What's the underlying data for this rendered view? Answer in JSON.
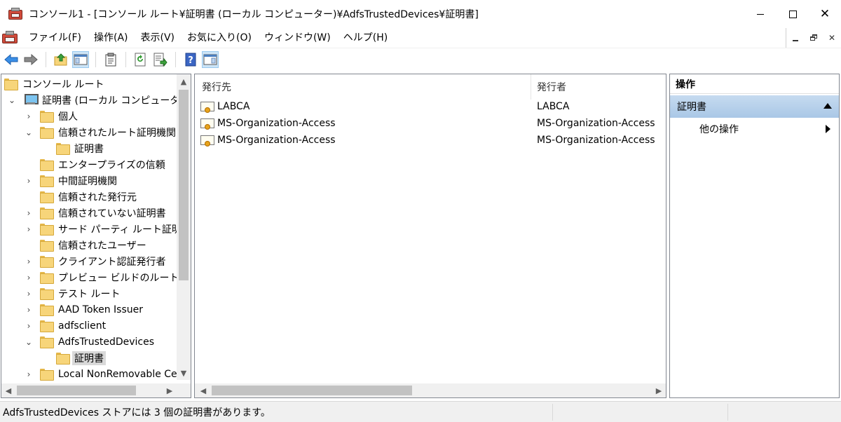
{
  "window": {
    "title": "コンソール1 - [コンソール ルート¥証明書 (ローカル コンピューター)¥AdfsTrustedDevices¥証明書]",
    "controls": {
      "minimize": "minimize-icon",
      "maximize": "maximize-icon",
      "close": "close-icon",
      "close_glyph": "✕"
    }
  },
  "menubar": {
    "items": [
      {
        "label": "ファイル(F)"
      },
      {
        "label": "操作(A)"
      },
      {
        "label": "表示(V)"
      },
      {
        "label": "お気に入り(O)"
      },
      {
        "label": "ウィンドウ(W)"
      },
      {
        "label": "ヘルプ(H)"
      }
    ]
  },
  "toolbar": {
    "buttons": [
      {
        "icon": "back-arrow-icon"
      },
      {
        "icon": "forward-arrow-icon"
      },
      {
        "icon": "up-folder-icon"
      },
      {
        "icon": "show-hide-tree-icon"
      },
      {
        "icon": "properties-icon"
      },
      {
        "icon": "refresh-icon"
      },
      {
        "icon": "export-list-icon"
      },
      {
        "icon": "help-icon"
      },
      {
        "icon": "show-hide-action-pane-icon"
      }
    ]
  },
  "tree": {
    "items": [
      {
        "label": "コンソール ルート",
        "level": 0,
        "expander": "",
        "icon": "folder-icon"
      },
      {
        "label": "証明書 (ローカル コンピューター)",
        "level": 0,
        "expander": "⌄",
        "icon": "computer-icon"
      },
      {
        "label": "個人",
        "level": 1,
        "expander": "›",
        "icon": "folder-icon"
      },
      {
        "label": "信頼されたルート証明機関",
        "level": 1,
        "expander": "⌄",
        "icon": "folder-icon"
      },
      {
        "label": "証明書",
        "level": 2,
        "expander": "",
        "icon": "folder-icon"
      },
      {
        "label": "エンタープライズの信頼",
        "level": 1,
        "expander": "",
        "icon": "folder-icon"
      },
      {
        "label": "中間証明機関",
        "level": 1,
        "expander": "›",
        "icon": "folder-icon"
      },
      {
        "label": "信頼された発行元",
        "level": 1,
        "expander": "",
        "icon": "folder-icon"
      },
      {
        "label": "信頼されていない証明書",
        "level": 1,
        "expander": "›",
        "icon": "folder-icon"
      },
      {
        "label": "サード パーティ ルート証明機関",
        "level": 1,
        "expander": "›",
        "icon": "folder-icon"
      },
      {
        "label": "信頼されたユーザー",
        "level": 1,
        "expander": "",
        "icon": "folder-icon"
      },
      {
        "label": "クライアント認証発行者",
        "level": 1,
        "expander": "›",
        "icon": "folder-icon"
      },
      {
        "label": "プレビュー ビルドのルート",
        "level": 1,
        "expander": "›",
        "icon": "folder-icon"
      },
      {
        "label": "テスト ルート",
        "level": 1,
        "expander": "›",
        "icon": "folder-icon"
      },
      {
        "label": "AAD Token Issuer",
        "level": 1,
        "expander": "›",
        "icon": "folder-icon"
      },
      {
        "label": "adfsclient",
        "level": 1,
        "expander": "›",
        "icon": "folder-icon"
      },
      {
        "label": "AdfsTrustedDevices",
        "level": 1,
        "expander": "⌄",
        "icon": "folder-icon"
      },
      {
        "label": "証明書",
        "level": 2,
        "expander": "",
        "icon": "folder-icon",
        "selected": true
      },
      {
        "label": "Local NonRemovable Certificates",
        "level": 1,
        "expander": "›",
        "icon": "folder-icon"
      }
    ]
  },
  "list": {
    "columns": [
      {
        "label": "発行先"
      },
      {
        "label": "発行者"
      }
    ],
    "rows": [
      {
        "issued_to": "LABCA",
        "issued_by": "LABCA"
      },
      {
        "issued_to": "MS-Organization-Access",
        "issued_by": "MS-Organization-Access"
      },
      {
        "issued_to": "MS-Organization-Access",
        "issued_by": "MS-Organization-Access"
      }
    ]
  },
  "actions": {
    "title": "操作",
    "section": "証明書",
    "items": [
      {
        "label": "他の操作"
      }
    ]
  },
  "status": {
    "text": "AdfsTrustedDevices ストアには 3 個の証明書があります。"
  }
}
